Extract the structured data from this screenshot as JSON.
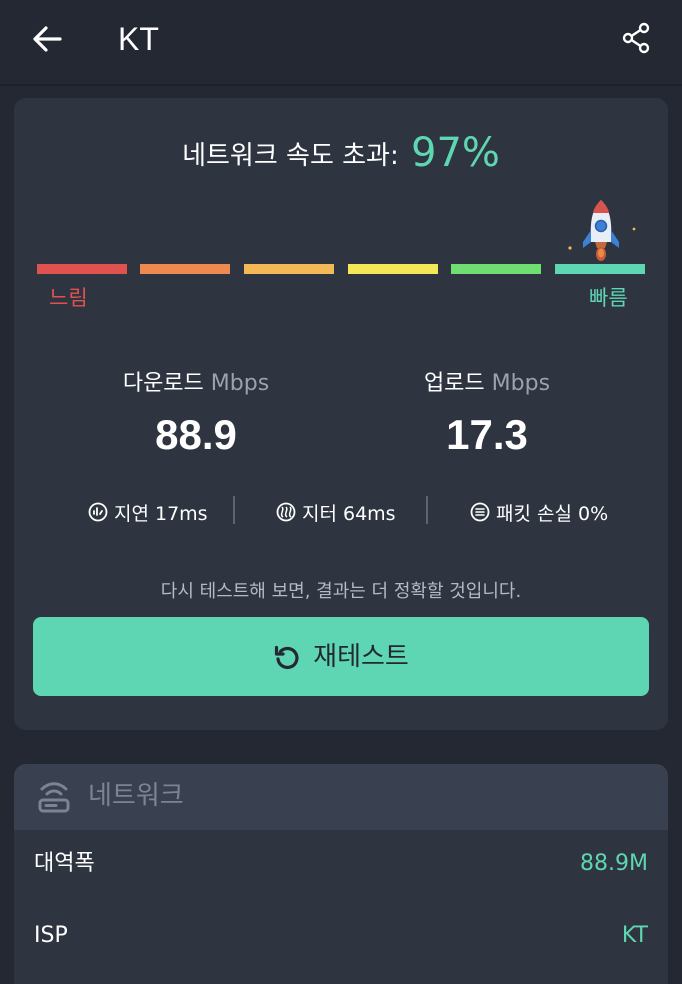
{
  "header": {
    "title": "KT"
  },
  "result": {
    "headline_label": "네트워크 속도 초과:",
    "headline_percent": "97%",
    "scale": {
      "slow_label": "느림",
      "fast_label": "빠름",
      "segment_colors": [
        "#e0524f",
        "#ee8a4f",
        "#f2b956",
        "#f5e856",
        "#6fdf72",
        "#5fd6b3"
      ]
    },
    "download": {
      "label": "다운로드",
      "unit": "Mbps",
      "value": "88.9"
    },
    "upload": {
      "label": "업로드",
      "unit": "Mbps",
      "value": "17.3"
    },
    "stats": {
      "latency_label": "지연 17ms",
      "jitter_label": "지터 64ms",
      "packet_loss_label": "패킷 손실 0%"
    },
    "hint": "다시 테스트해 보면, 결과는 더 정확할 것입니다.",
    "retest_label": "재테스트"
  },
  "network": {
    "title": "네트워크",
    "rows": [
      {
        "label": "대역폭",
        "value": "88.9M"
      },
      {
        "label": "ISP",
        "value": "KT"
      }
    ]
  },
  "colors": {
    "accent": "#5fd6b3",
    "background": "#232833",
    "card": "#2e3440"
  }
}
